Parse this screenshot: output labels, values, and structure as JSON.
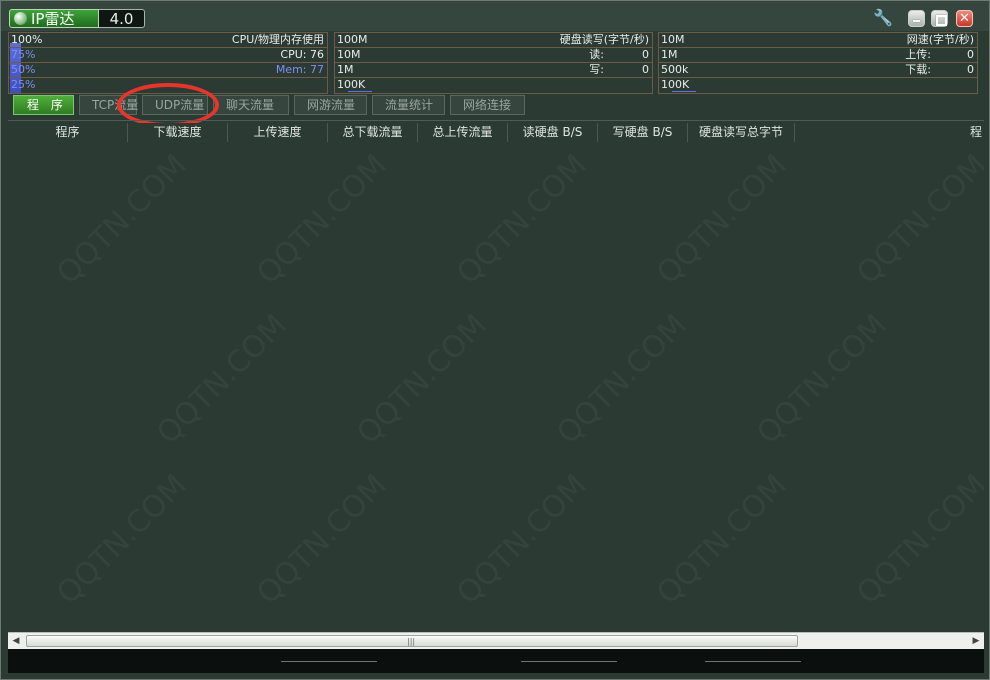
{
  "app": {
    "title": "IP雷达",
    "version": "4.0"
  },
  "titlebar": {
    "settings_icon": "wrench-icon",
    "minimize_icon": "minimize-icon",
    "maximize_icon": "maximize-icon",
    "close_icon": "close-icon",
    "close_glyph": "✕"
  },
  "cpu_panel": {
    "title": "CPU/物理内存使用",
    "scale_100": "100%",
    "scale_75": "75%",
    "scale_50": "50%",
    "scale_25": "25%",
    "cpu_label": "CPU:",
    "cpu_value": "76",
    "mem_label": "Mem:",
    "mem_value": "77"
  },
  "disk_panel": {
    "title": "硬盘读写(字节/秒)",
    "scale_1": "100M",
    "scale_2": "10M",
    "scale_3": "1M",
    "scale_4": "100K",
    "read_label": "读:",
    "read_value": "0",
    "write_label": "写:",
    "write_value": "0"
  },
  "net_panel": {
    "title": "网速(字节/秒)",
    "scale_1": "10M",
    "scale_2": "1M",
    "scale_3": "500k",
    "scale_4": "100K",
    "up_label": "上传:",
    "up_value": "0",
    "down_label": "下载:",
    "down_value": "0"
  },
  "tabs": [
    {
      "label": "程 序",
      "active": true
    },
    {
      "label": "TCP流量",
      "active": false
    },
    {
      "label": "UDP流量",
      "active": false
    },
    {
      "label": "聊天流量",
      "active": false
    },
    {
      "label": "网游流量",
      "active": false
    },
    {
      "label": "流量统计",
      "active": false
    },
    {
      "label": "网络连接",
      "active": false
    }
  ],
  "table": {
    "columns": [
      "程序",
      "下载速度",
      "上传速度",
      "总下载流量",
      "总上传流量",
      "读硬盘 B/S",
      "写硬盘 B/S",
      "硬盘读写总字节",
      "程"
    ]
  },
  "watermark": "QQTN.COM",
  "colors": {
    "background": "#2b3b34",
    "panel_border": "#6f5a46",
    "active_tab": "#3f9a2f",
    "annotation": "#e8352b",
    "graph_blue": "#5b6fd6",
    "wrench": "#f3b53a",
    "close_button": "#c8362a"
  }
}
